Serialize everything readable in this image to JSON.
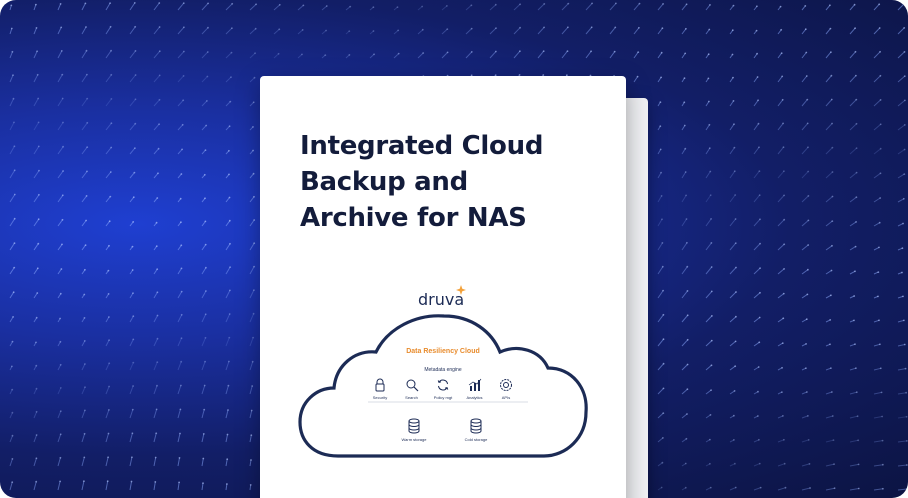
{
  "banner": {
    "accent_color": "#1f3fd1",
    "dark_color": "#0c1443"
  },
  "document": {
    "title_lines": [
      "Integrated Cloud",
      "Backup and",
      "Archive for NAS"
    ],
    "title_color": "#131c3b",
    "logo_text": "druva",
    "logo_accent_color": "#f3a23c",
    "diagram": {
      "heading": "Data Resiliency Cloud",
      "subheading": "Metadata engine",
      "features": [
        {
          "label": "Security",
          "icon": "lock-icon"
        },
        {
          "label": "Search",
          "icon": "search-icon"
        },
        {
          "label": "Policy mgt",
          "icon": "refresh-icon"
        },
        {
          "label": "Analytics",
          "icon": "analytics-icon"
        },
        {
          "label": "APIs",
          "icon": "api-icon"
        }
      ],
      "storage": [
        {
          "label": "Warm storage",
          "icon": "database-icon"
        },
        {
          "label": "Cold storage",
          "icon": "database-icon"
        }
      ]
    }
  }
}
